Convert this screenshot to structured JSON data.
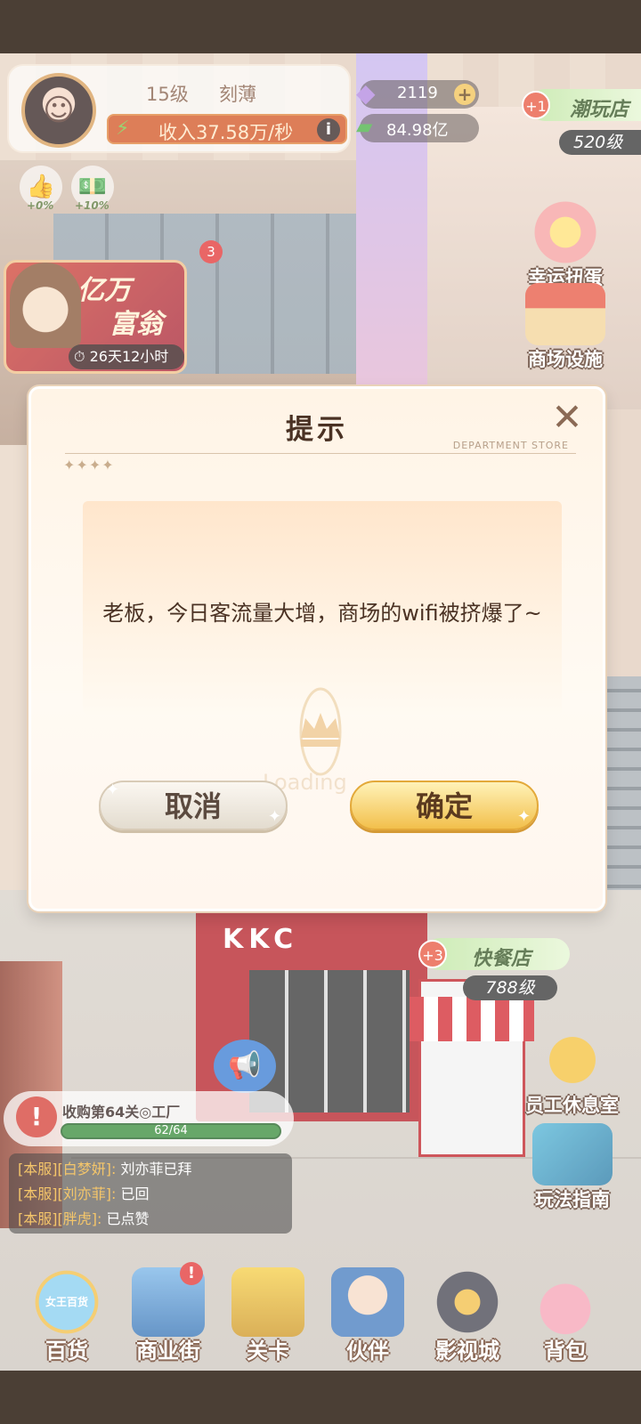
{
  "player": {
    "level": "15级",
    "name": "刻薄",
    "income": "收入37.58万/秒",
    "info_label": "i"
  },
  "resources": {
    "gems": "2119",
    "cash": "84.98亿",
    "plus_label": "+"
  },
  "buffs": [
    {
      "label": "+0%"
    },
    {
      "label": "+10%"
    }
  ],
  "shop_tag": {
    "badge": "+1",
    "name": "潮玩店",
    "level": "520级"
  },
  "event": {
    "title_line1": "亿万",
    "title_line2": "富翁",
    "timer": "26天12小时",
    "badge": "3"
  },
  "side_buttons": [
    {
      "label": "幸运扭蛋"
    },
    {
      "label": "商场设施"
    },
    {
      "label": "员工休息室"
    },
    {
      "label": "玩法指南"
    }
  ],
  "store_kkc": {
    "sign": "KKC",
    "badge": "+3",
    "name": "快餐店",
    "level": "788级"
  },
  "task": {
    "title": "收购第64关◎工厂",
    "progress": "62/64",
    "progress_fraction": 0.97
  },
  "chat": [
    {
      "tag": "[本服]",
      "user": "[白梦妍]:",
      "text": "刘亦菲已拜"
    },
    {
      "tag": "[本服]",
      "user": "[刘亦菲]:",
      "text": "已回"
    },
    {
      "tag": "[本服]",
      "user": "[胖虎]:",
      "text": "已点赞"
    }
  ],
  "bottom_nav": [
    {
      "label": "百货",
      "icon_text": "女王百货"
    },
    {
      "label": "商业街",
      "alert": "!"
    },
    {
      "label": "关卡"
    },
    {
      "label": "伙伴"
    },
    {
      "label": "影视城"
    },
    {
      "label": "背包"
    }
  ],
  "dialog": {
    "title": "提示",
    "subtitle": "DEPARTMENT STORE",
    "stars": "✦✦✦✦",
    "close": "✕",
    "message": "老板，今日客流量大增，商场的wifi被挤爆了~",
    "loading": "Loading",
    "cancel": "取消",
    "confirm": "确定"
  },
  "colors": {
    "accent_gold": "#f2c04c",
    "income_bar": "#d45a2a",
    "event_red": "#d24a3c"
  }
}
